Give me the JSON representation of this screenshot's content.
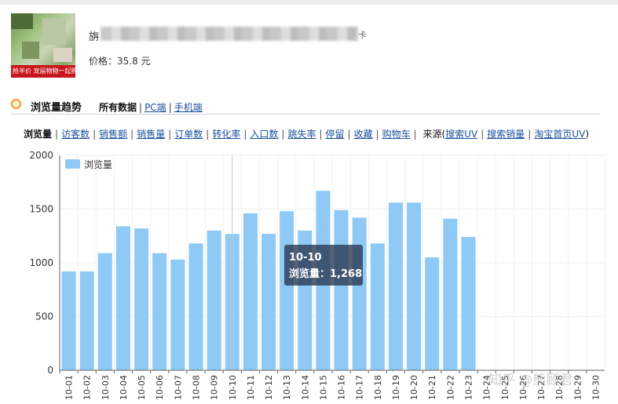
{
  "product": {
    "title_start": "旃",
    "title_end": "卡",
    "price_label": "价格：",
    "price_value": "35.8",
    "price_unit": "元",
    "thumbnail_banner": "抢半价 宠届物物一起购 宠届半价"
  },
  "trend": {
    "title": "浏览量趋势",
    "range_tabs": [
      "所有数据",
      "PC端",
      "手机端"
    ]
  },
  "metrics": {
    "items": [
      "浏览量",
      "访客数",
      "销售额",
      "销售量",
      "订单数",
      "转化率",
      "入口数",
      "跳失率",
      "停留",
      "收藏",
      "购物车"
    ],
    "source_label": "来源(",
    "source_items": [
      "搜索UV",
      "搜索销量",
      "淘宝首页UV"
    ],
    "source_close": ")"
  },
  "tooltip": {
    "date": "10-10",
    "label": "浏览量：",
    "value": "1,268"
  },
  "watermark": "知乎 @熊顾君",
  "colors": {
    "bar": "#8ecaf5",
    "link": "#1a4f9c",
    "icon_ring": "#f39a1e"
  },
  "chart_data": {
    "type": "bar",
    "categories": [
      "10-01",
      "10-02",
      "10-03",
      "10-04",
      "10-05",
      "10-06",
      "10-07",
      "10-08",
      "10-09",
      "10-10",
      "10-11",
      "10-12",
      "10-13",
      "10-14",
      "10-15",
      "10-16",
      "10-17",
      "10-18",
      "10-19",
      "10-20",
      "10-21",
      "10-22",
      "10-23",
      "10-24",
      "10-25",
      "10-26",
      "10-27",
      "10-28",
      "10-29",
      "10-30"
    ],
    "series": [
      {
        "name": "浏览量",
        "values": [
          920,
          920,
          1090,
          1340,
          1320,
          1090,
          1030,
          1180,
          1300,
          1268,
          1460,
          1270,
          1480,
          1300,
          1670,
          1490,
          1420,
          1180,
          1560,
          1560,
          1050,
          1410,
          1240,
          null,
          null,
          null,
          null,
          null,
          null,
          null
        ]
      }
    ],
    "ylim": [
      0,
      2000
    ],
    "yticks": [
      0,
      500,
      1000,
      1500,
      2000
    ],
    "grid": true,
    "legend": "top-left",
    "xlabel": "",
    "ylabel": "",
    "title": ""
  }
}
